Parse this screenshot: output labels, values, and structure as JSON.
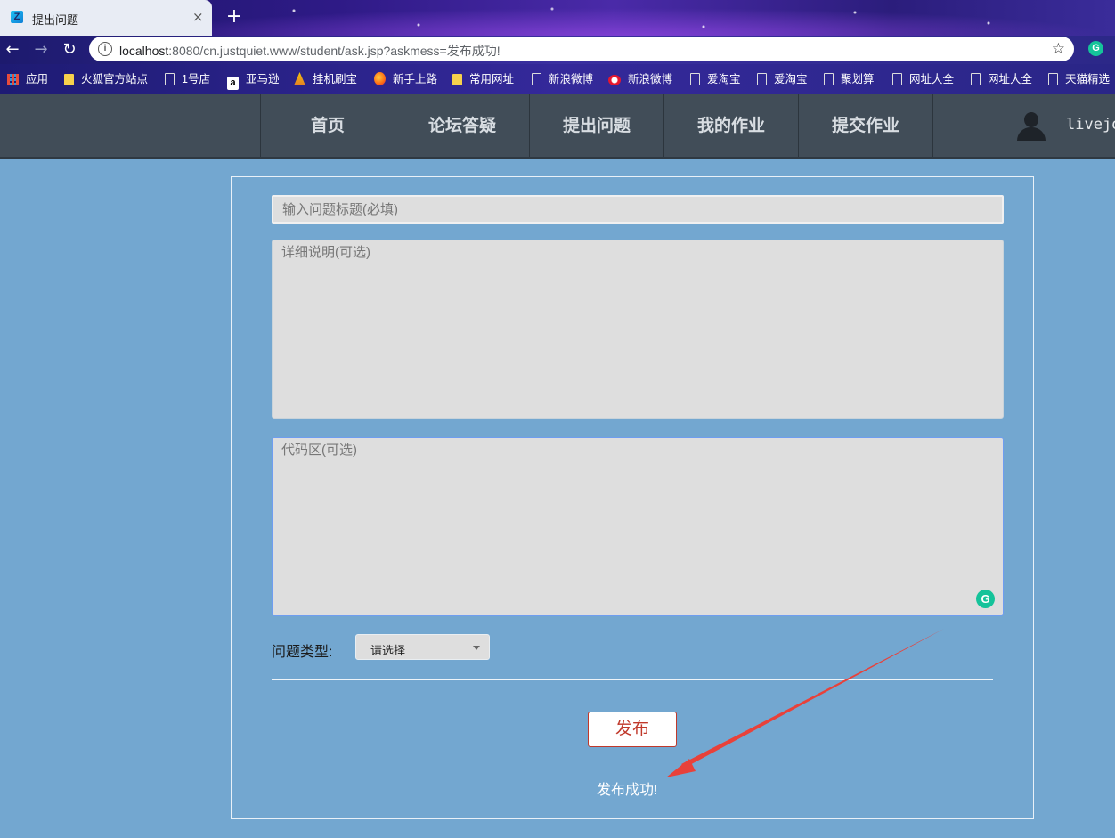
{
  "browser": {
    "tab_title": "提出问题",
    "tab_favicon_letter": "Z",
    "close_glyph": "×",
    "new_tab_glyph": "+",
    "url_host": "localhost",
    "url_rest": ":8080/cn.justquiet.www/student/ask.jsp?askmess=发布成功!",
    "extension_letter": "G",
    "bookmarks": [
      {
        "label": "应用",
        "icon": "apps-grid-icon"
      },
      {
        "label": "火狐官方站点",
        "icon": "folder-icon"
      },
      {
        "label": "1号店",
        "icon": "page-icon"
      },
      {
        "label": "亚马逊",
        "icon": "amazon-icon"
      },
      {
        "label": "挂机刷宝",
        "icon": "tower-icon"
      },
      {
        "label": "新手上路",
        "icon": "firefox-icon"
      },
      {
        "label": "常用网址",
        "icon": "folder-icon"
      },
      {
        "label": "新浪微博",
        "icon": "page-icon"
      },
      {
        "label": "新浪微博",
        "icon": "weibo-icon"
      },
      {
        "label": "爱淘宝",
        "icon": "page-icon"
      },
      {
        "label": "爱淘宝",
        "icon": "page-icon"
      },
      {
        "label": "聚划算",
        "icon": "page-icon"
      },
      {
        "label": "网址大全",
        "icon": "page-icon"
      },
      {
        "label": "网址大全",
        "icon": "page-icon"
      },
      {
        "label": "天猫精选",
        "icon": "page-icon"
      }
    ]
  },
  "nav": {
    "items": [
      "首页",
      "论坛答疑",
      "提出问题",
      "我的作业",
      "提交作业"
    ],
    "username": "livejo"
  },
  "form": {
    "title_placeholder": "输入问题标题(必填)",
    "detail_placeholder": "详细说明(可选)",
    "code_placeholder": "代码区(可选)",
    "type_label": "问题类型:",
    "type_selected": "请选择",
    "publish_label": "发布",
    "success_message": "发布成功!",
    "grammarly_letter": "G"
  },
  "colors": {
    "page_bg": "#73a7d0",
    "nav_bg": "#414d58",
    "publish_accent": "#c0392b",
    "annotation_arrow": "#e8413a"
  }
}
